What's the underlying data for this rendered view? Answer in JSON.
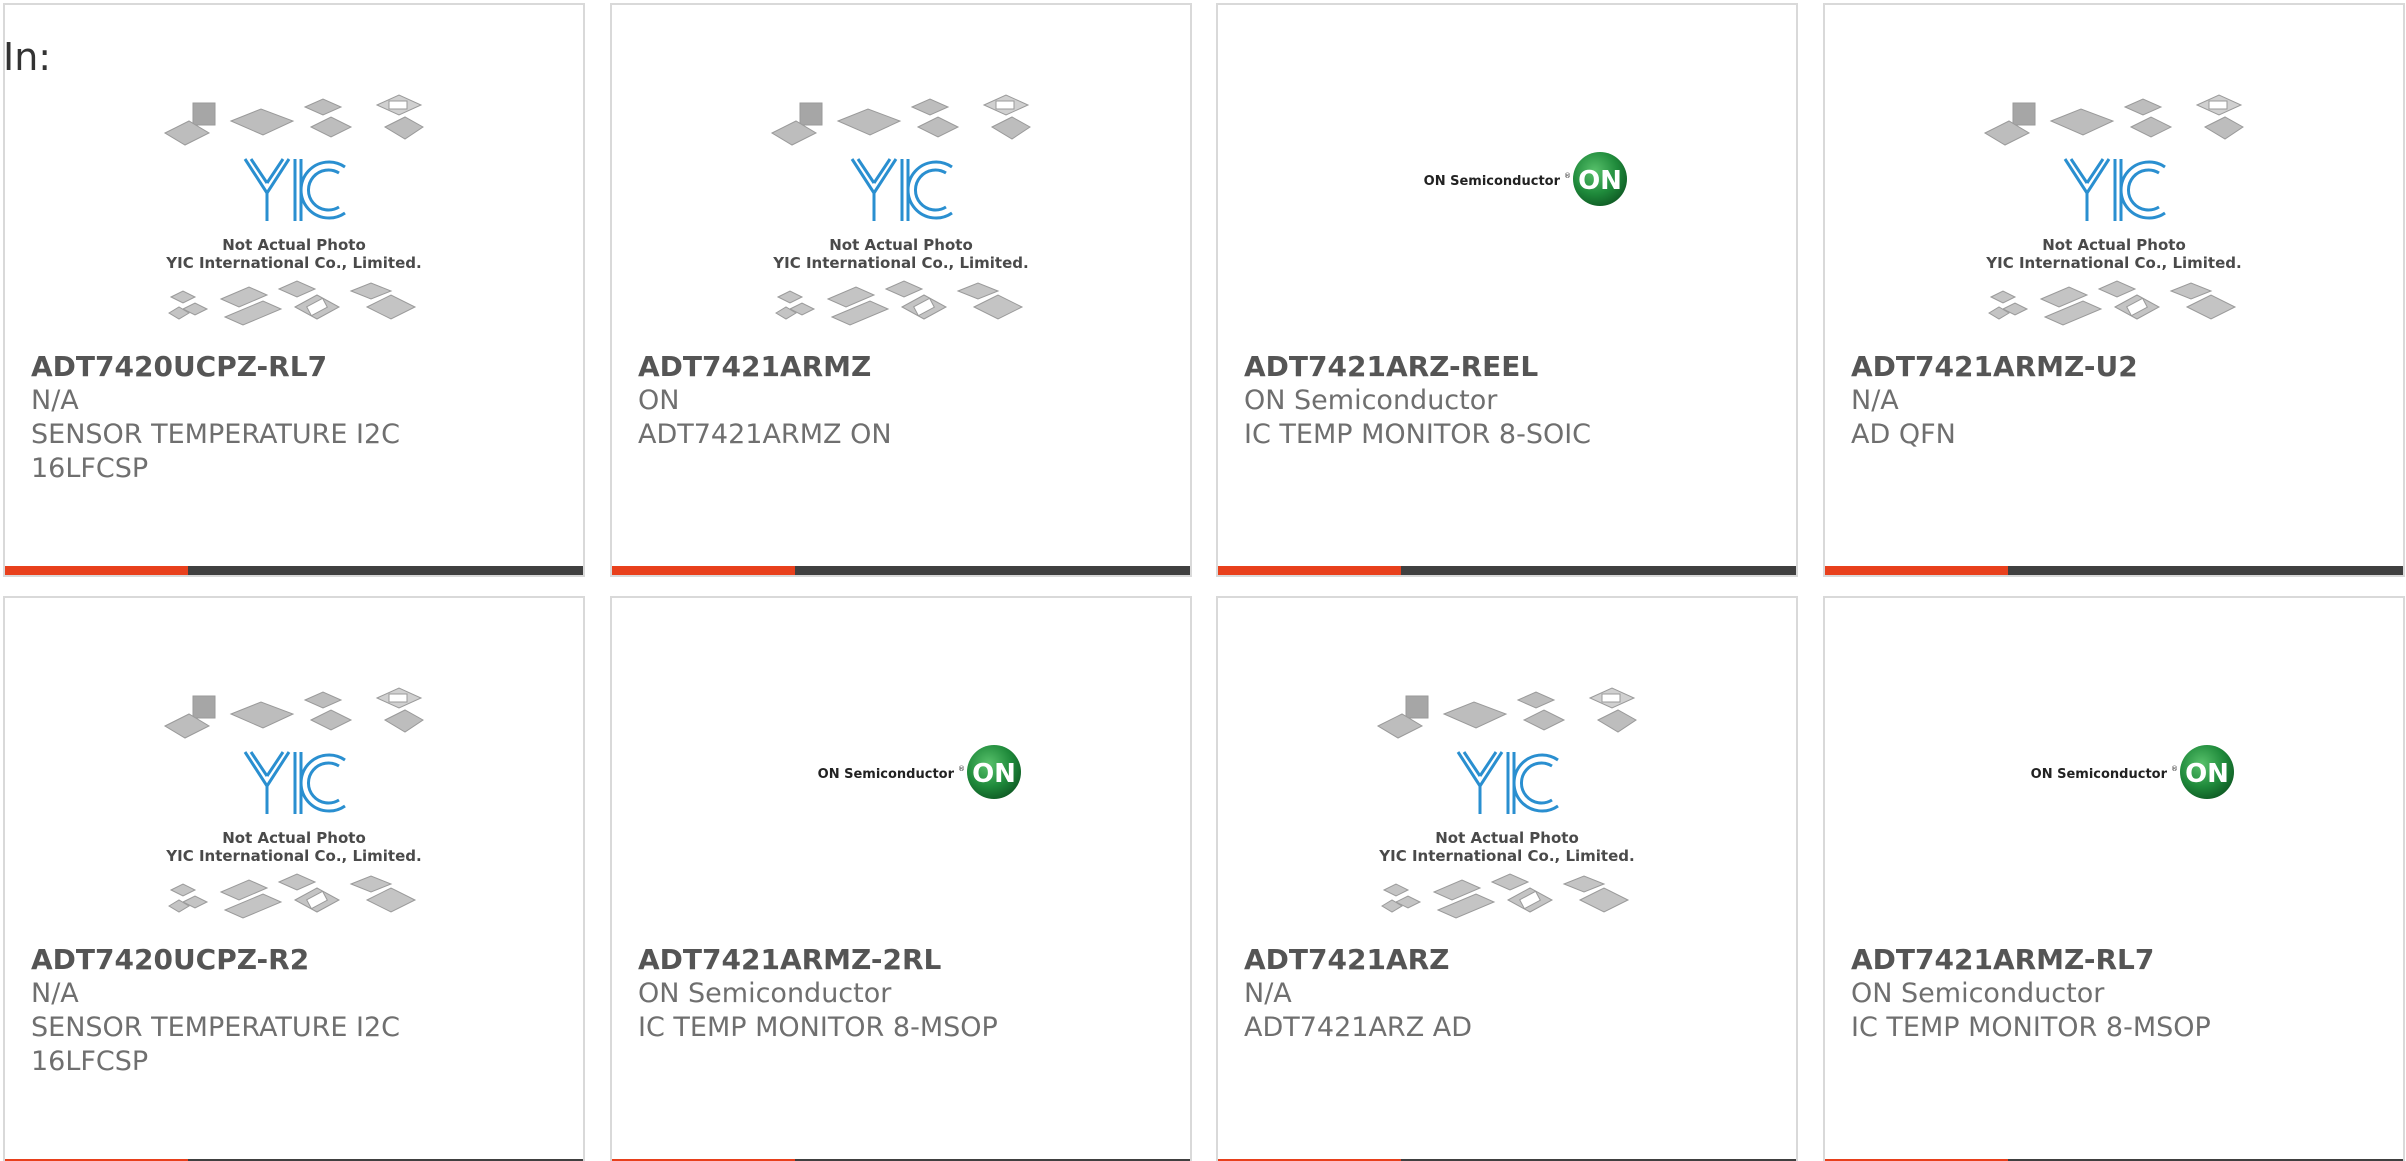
{
  "in_label": "In:",
  "colors": {
    "accent": "#e8401c",
    "bar_dark": "#404040",
    "yic_blue": "#2a8fd0",
    "on_green": "#1f8a3b"
  },
  "images": {
    "yic_caption_line1": "Not Actual Photo",
    "yic_caption_line2": "YIC International Co., Limited.",
    "on_brand_text": "ON Semiconductor",
    "on_badge_text": "ON"
  },
  "products": [
    {
      "part": "ADT7420UCPZ-RL7",
      "manufacturer": "N/A",
      "desc1": "SENSOR TEMPERATURE I2C",
      "desc2": "16LFCSP",
      "image": "yic"
    },
    {
      "part": "ADT7421ARMZ",
      "manufacturer": "ON",
      "desc1": "ADT7421ARMZ ON",
      "desc2": "",
      "image": "yic"
    },
    {
      "part": "ADT7421ARZ-REEL",
      "manufacturer": "ON Semiconductor",
      "desc1": "IC TEMP MONITOR 8-SOIC",
      "desc2": "",
      "image": "on"
    },
    {
      "part": "ADT7421ARMZ-U2",
      "manufacturer": "N/A",
      "desc1": "AD QFN",
      "desc2": "",
      "image": "yic"
    },
    {
      "part": "ADT7420UCPZ-R2",
      "manufacturer": "N/A",
      "desc1": "SENSOR TEMPERATURE I2C",
      "desc2": "16LFCSP",
      "image": "yic"
    },
    {
      "part": "ADT7421ARMZ-2RL",
      "manufacturer": "ON Semiconductor",
      "desc1": "IC TEMP MONITOR 8-MSOP",
      "desc2": "",
      "image": "on"
    },
    {
      "part": "ADT7421ARZ",
      "manufacturer": "N/A",
      "desc1": "ADT7421ARZ AD",
      "desc2": "",
      "image": "yic"
    },
    {
      "part": "ADT7421ARMZ-RL7",
      "manufacturer": "ON Semiconductor",
      "desc1": "IC TEMP MONITOR 8-MSOP",
      "desc2": "",
      "image": "on"
    }
  ]
}
